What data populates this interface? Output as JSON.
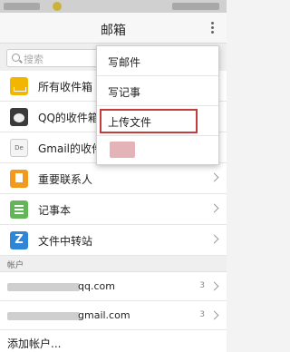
{
  "header": {
    "title": "邮箱"
  },
  "search": {
    "placeholder": "搜索"
  },
  "folders": [
    {
      "label": "所有收件箱",
      "icon": "inbox-icon"
    },
    {
      "label": "QQ的收件箱",
      "icon": "qq-panda-icon"
    },
    {
      "label": "Gmail的收件箱",
      "icon": "gmail-icon"
    },
    {
      "label": "重要联系人",
      "icon": "star-bookmark-icon"
    },
    {
      "label": "记事本",
      "icon": "notepad-icon"
    },
    {
      "label": "文件中转站",
      "icon": "transfer-station-icon"
    }
  ],
  "accounts": {
    "section_label": "帐户",
    "items": [
      {
        "suffix": "qq.com",
        "count": "3"
      },
      {
        "suffix": "gmail.com",
        "count": "3"
      }
    ],
    "add_label": "添加帐户..."
  },
  "menu": {
    "items": [
      {
        "label": "写邮件"
      },
      {
        "label": "写记事"
      },
      {
        "label": "上传文件"
      }
    ]
  },
  "colors": {
    "highlight_box": "#c43c3c",
    "inbox_icon": "#f2b600",
    "transfer_icon": "#2f86d6"
  }
}
